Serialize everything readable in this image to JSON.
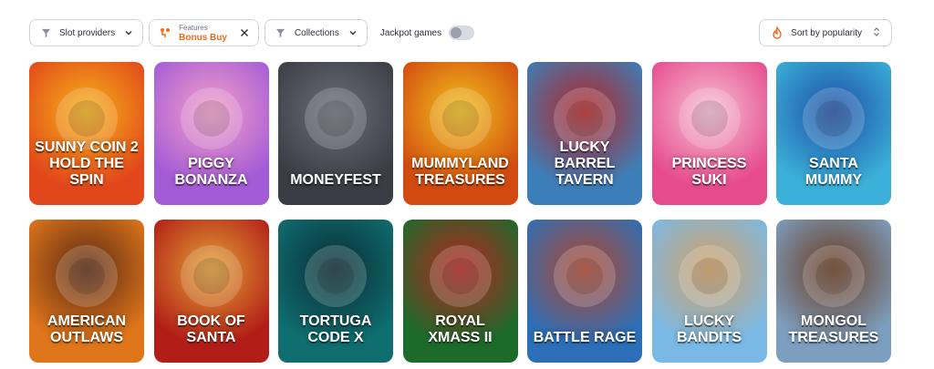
{
  "filters": {
    "slot_providers": "Slot providers",
    "features_caption": "Features",
    "features_value": "Bonus Buy",
    "collections": "Collections",
    "jackpot_label": "Jackpot games",
    "jackpot_enabled": false,
    "sort_label": "Sort by popularity"
  },
  "colors": {
    "accent": "#f26a1b",
    "border": "#cfd3da"
  },
  "games": [
    {
      "title": "Sunny Coin 2 Hold The Spin",
      "bg": "#e2471b",
      "bg2": "#f6b318"
    },
    {
      "title": "Piggy Bonanza",
      "bg": "#a45bd6",
      "bg2": "#f3a0c8"
    },
    {
      "title": "Moneyfest",
      "bg": "#3a3d44",
      "bg2": "#6a6e78"
    },
    {
      "title": "Mummyland Treasures",
      "bg": "#d24a10",
      "bg2": "#f1c21b"
    },
    {
      "title": "Lucky Barrel Tavern",
      "bg": "#3c7fb8",
      "bg2": "#b72323"
    },
    {
      "title": "Princess Suki",
      "bg": "#e64b8c",
      "bg2": "#f6c1d6"
    },
    {
      "title": "Santa Mummy",
      "bg": "#3bb0d8",
      "bg2": "#1e4ea6"
    },
    {
      "title": "American Outlaws",
      "bg": "#e0761b",
      "bg2": "#5a2a12"
    },
    {
      "title": "Book of Santa",
      "bg": "#b21d17",
      "bg2": "#e1a233"
    },
    {
      "title": "Tortuga Code X",
      "bg": "#0f6e70",
      "bg2": "#0a2d34"
    },
    {
      "title": "Royal Xmass II",
      "bg": "#1c6b2b",
      "bg2": "#b8231f"
    },
    {
      "title": "Battle Rage",
      "bg": "#2c6fb8",
      "bg2": "#b2462a"
    },
    {
      "title": "Lucky Bandits",
      "bg": "#7ab9e6",
      "bg2": "#d4a063"
    },
    {
      "title": "Mongol Treasures",
      "bg": "#7d9fbf",
      "bg2": "#6b3a1e"
    }
  ]
}
